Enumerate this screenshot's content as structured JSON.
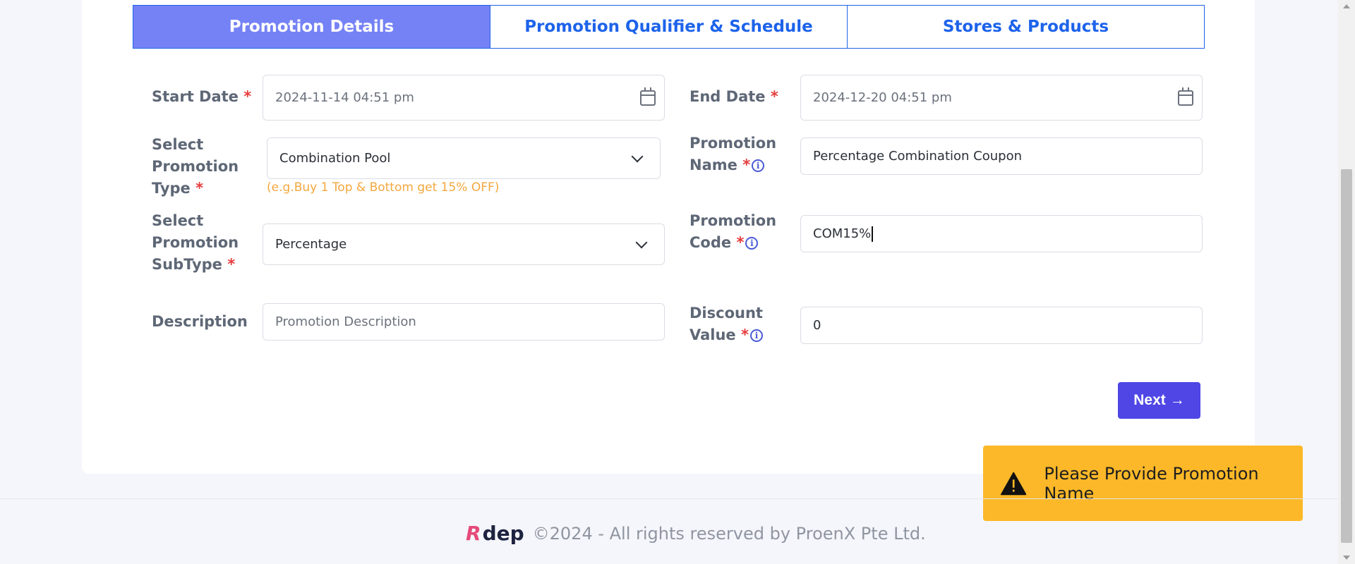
{
  "tabs": [
    {
      "label": "Promotion Details",
      "active": true
    },
    {
      "label": "Promotion Qualifier & Schedule",
      "active": false
    },
    {
      "label": "Stores & Products",
      "active": false
    }
  ],
  "form": {
    "start_date": {
      "label": "Start Date",
      "value": "2024-11-14 04:51 pm"
    },
    "end_date": {
      "label": "End Date",
      "value": "2024-12-20 04:51 pm"
    },
    "promotion_type": {
      "label_lines": [
        "Select",
        "Promotion",
        "Type"
      ],
      "value": "Combination Pool",
      "hint": "(e.g.Buy 1 Top & Bottom get 15% OFF)"
    },
    "promotion_name": {
      "label_lines": [
        "Promotion",
        "Name"
      ],
      "value": "Percentage Combination Coupon"
    },
    "promotion_subtype": {
      "label_lines": [
        "Select",
        "Promotion",
        "SubType"
      ],
      "value": "Percentage"
    },
    "promotion_code": {
      "label_lines": [
        "Promotion",
        "Code"
      ],
      "value": "COM15%"
    },
    "description": {
      "label": "Description",
      "placeholder": "Promotion Description"
    },
    "discount_value": {
      "label_lines": [
        "Discount",
        "Value"
      ],
      "value": "0"
    },
    "required_mark": "*",
    "info_glyph": "i"
  },
  "next_button": {
    "label": "Next",
    "arrow": "→"
  },
  "toast": {
    "message": "Please Provide Promotion Name",
    "color": "#fcb828"
  },
  "footer": {
    "logo_mark": "R",
    "logo_text": "dep",
    "copyright": "©2024 - All rights reserved by ProenX Pte Ltd."
  },
  "colors": {
    "accent": "#4f46e5",
    "active_tab": "#7582f5",
    "tab_text": "#1d63ea",
    "required": "#e53d3d",
    "hint": "#f3a73d"
  }
}
